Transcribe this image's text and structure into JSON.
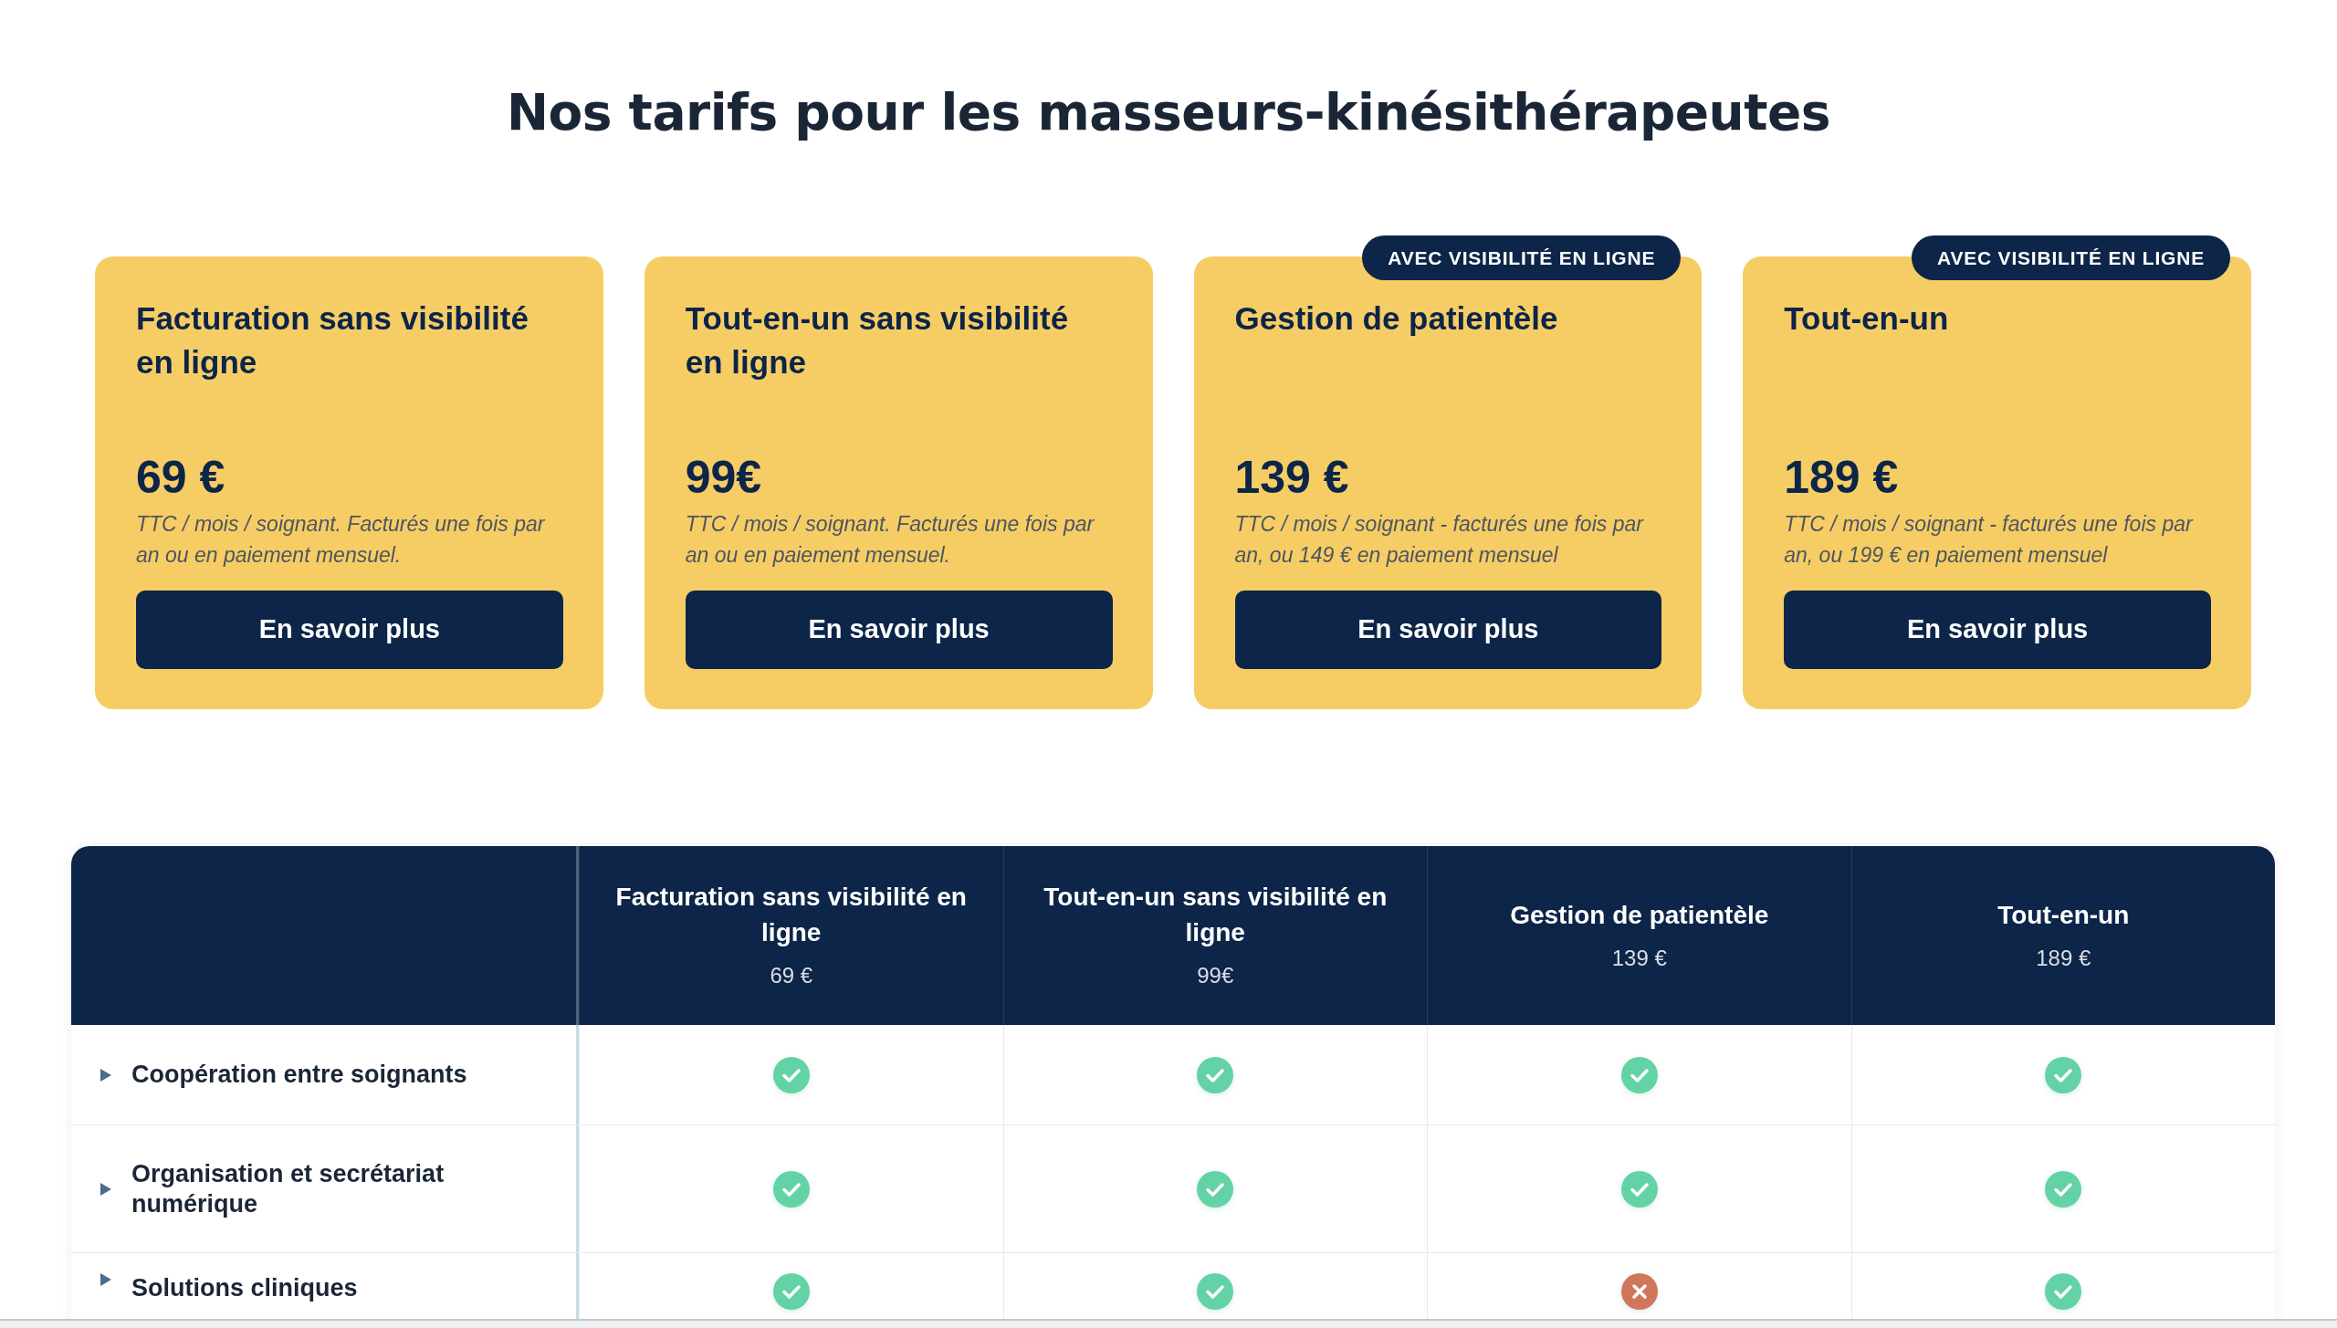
{
  "heading": "Nos tarifs pour les masseurs-kinésithérapeutes",
  "plans": [
    {
      "title": "Facturation sans visibilité en ligne",
      "price": "69 €",
      "note": "TTC / mois / soignant. Facturés une fois par an ou en paiement mensuel.",
      "button": "En savoir plus"
    },
    {
      "title": "Tout-en-un sans visibilité en ligne",
      "price": "99€",
      "note": "TTC / mois / soignant. Facturés une fois par an ou en paiement mensuel.",
      "button": "En savoir plus"
    },
    {
      "badge": "AVEC VISIBILITÉ EN LIGNE",
      "title": "Gestion de patientèle",
      "price": "139 €",
      "note": "TTC / mois / soignant - facturés une fois par an, ou 149 € en paiement mensuel",
      "button": "En savoir plus"
    },
    {
      "badge": "AVEC VISIBILITÉ EN LIGNE",
      "title": "Tout-en-un",
      "price": "189 €",
      "note": "TTC / mois / soignant - facturés une fois par an, ou 199 € en paiement mensuel",
      "button": "En savoir plus"
    }
  ],
  "comparison": {
    "columns": [
      {
        "name": "Facturation sans visibilité en ligne",
        "price": "69 €"
      },
      {
        "name": "Tout-en-un sans visibilité en ligne",
        "price": "99€"
      },
      {
        "name": "Gestion de patientèle",
        "price": "139 €"
      },
      {
        "name": "Tout-en-un",
        "price": "189 €"
      }
    ],
    "rows": [
      {
        "label": "Coopération entre soignants",
        "expanded": false,
        "included": [
          true,
          true,
          true,
          true
        ]
      },
      {
        "label": "Organisation et secrétariat numérique",
        "expanded": false,
        "included": [
          true,
          true,
          true,
          true
        ]
      },
      {
        "label": "Solutions cliniques",
        "expanded": false,
        "included": [
          true,
          true,
          false,
          true
        ]
      }
    ]
  }
}
